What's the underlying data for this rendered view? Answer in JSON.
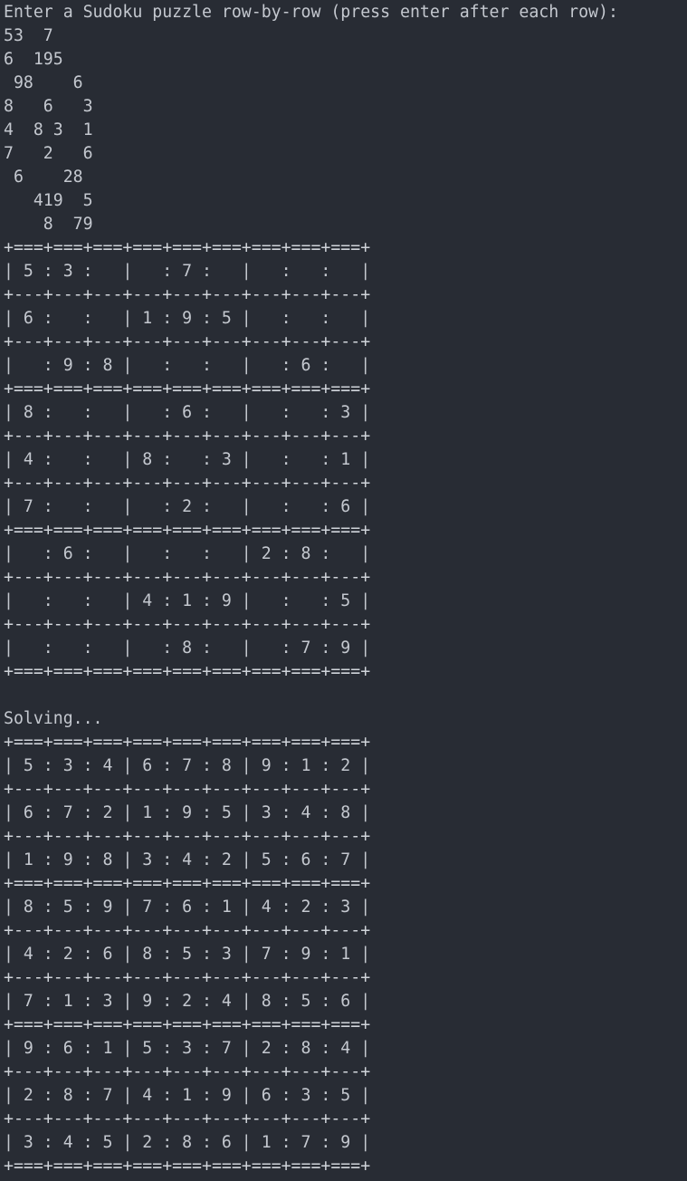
{
  "terminal": {
    "prompt": "Enter a Sudoku puzzle row-by-row (press enter after each row):",
    "input_rows": [
      "53  7",
      "6  195",
      " 98    6",
      "8   6   3",
      "4  8 3  1",
      "7   2   6",
      " 6    28",
      "   419  5",
      "    8  79"
    ],
    "thick_border": "+===+===+===+===+===+===+===+===+===+",
    "thin_border": "+---+---+---+---+---+---+---+---+---+",
    "unsolved_grid": [
      [
        "5",
        "3",
        "",
        "",
        "7",
        "",
        "",
        "",
        ""
      ],
      [
        "6",
        "",
        "",
        "1",
        "9",
        "5",
        "",
        "",
        ""
      ],
      [
        "",
        "9",
        "8",
        "",
        "",
        "",
        "",
        "6",
        ""
      ],
      [
        "8",
        "",
        "",
        "",
        "6",
        "",
        "",
        "",
        "3"
      ],
      [
        "4",
        "",
        "",
        "8",
        "",
        "3",
        "",
        "",
        "1"
      ],
      [
        "7",
        "",
        "",
        "",
        "2",
        "",
        "",
        "",
        "6"
      ],
      [
        "",
        "6",
        "",
        "",
        "",
        "",
        "2",
        "8",
        ""
      ],
      [
        "",
        "",
        "",
        "4",
        "1",
        "9",
        "",
        "",
        "5"
      ],
      [
        "",
        "",
        "",
        "",
        "8",
        "",
        "",
        "7",
        "9"
      ]
    ],
    "status_message": "Solving...",
    "solved_grid": [
      [
        "5",
        "3",
        "4",
        "6",
        "7",
        "8",
        "9",
        "1",
        "2"
      ],
      [
        "6",
        "7",
        "2",
        "1",
        "9",
        "5",
        "3",
        "4",
        "8"
      ],
      [
        "1",
        "9",
        "8",
        "3",
        "4",
        "2",
        "5",
        "6",
        "7"
      ],
      [
        "8",
        "5",
        "9",
        "7",
        "6",
        "1",
        "4",
        "2",
        "3"
      ],
      [
        "4",
        "2",
        "6",
        "8",
        "5",
        "3",
        "7",
        "9",
        "1"
      ],
      [
        "7",
        "1",
        "3",
        "9",
        "2",
        "4",
        "8",
        "5",
        "6"
      ],
      [
        "9",
        "6",
        "1",
        "5",
        "3",
        "7",
        "2",
        "8",
        "4"
      ],
      [
        "2",
        "8",
        "7",
        "4",
        "1",
        "9",
        "6",
        "3",
        "5"
      ],
      [
        "3",
        "4",
        "5",
        "2",
        "8",
        "6",
        "1",
        "7",
        "9"
      ]
    ]
  }
}
